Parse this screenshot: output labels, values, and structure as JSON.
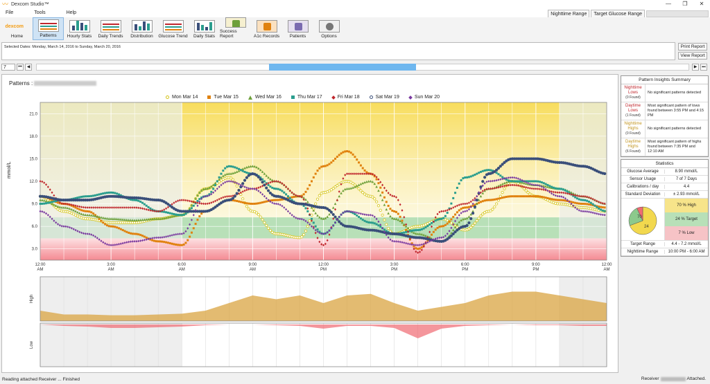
{
  "app": {
    "title": "Dexcom Studio™",
    "logo_text": "dexcom"
  },
  "window_buttons": [
    "—",
    "❐",
    "✕"
  ],
  "menu": [
    "File",
    "Tools",
    "Help"
  ],
  "topright": {
    "nighttime_range": "Nighttime Range",
    "target_glucose_range": "Target Glucose Range"
  },
  "toolbar": [
    {
      "label": "Home",
      "icon": "home-icon"
    },
    {
      "label": "Patterns",
      "icon": "patterns-icon",
      "active": true
    },
    {
      "label": "Hourly Stats",
      "icon": "hourly-stats-icon"
    },
    {
      "label": "Daily Trends",
      "icon": "daily-trends-icon"
    },
    {
      "label": "Distribution",
      "icon": "distribution-icon"
    },
    {
      "label": "Glucose Trend",
      "icon": "glucose-trend-icon"
    },
    {
      "label": "Daily Stats",
      "icon": "daily-stats-icon"
    },
    {
      "label": "Success Report",
      "icon": "success-report-icon"
    },
    {
      "label": "A1c Records",
      "icon": "a1c-records-icon"
    },
    {
      "label": "Patients",
      "icon": "patients-icon"
    },
    {
      "label": "Options",
      "icon": "options-icon"
    }
  ],
  "dates": {
    "selected": "Selected Dates: Monday, March 14, 2016 to Sunday, March 20, 2016"
  },
  "report_buttons": {
    "print": "Print Report",
    "view": "View Report"
  },
  "nav": {
    "days": "7",
    "first": "⏮",
    "prev": "◀",
    "next": "▶",
    "last": "⏭"
  },
  "patterns": {
    "title": "Patterns :"
  },
  "colors": {
    "high": "#f5d76a",
    "target": "#b8e0b8",
    "low": "#f6a3a8",
    "accent": "#6fb7ef"
  },
  "chart_data": {
    "type": "scatter",
    "ylabel": "mmol/L",
    "yticks": [
      "3.0",
      "6.0",
      "9.0",
      "12.0",
      "15.0",
      "18.0",
      "21.0"
    ],
    "ylim": [
      1.5,
      22.5
    ],
    "xticks": [
      "12:00\nAM",
      "3:00\nAM",
      "6:00\nAM",
      "9:00\nAM",
      "12:00\nPM",
      "3:00\nPM",
      "6:00\nPM",
      "9:00\nPM",
      "12:00\nAM"
    ],
    "target_range": [
      4.4,
      7.2
    ],
    "series": [
      {
        "name": "Mon Mar 14",
        "color": "#d4c418",
        "marker": "circle",
        "x": [
          0,
          1,
          2,
          3,
          4,
          5,
          6,
          7,
          8,
          9,
          10,
          11,
          12,
          13,
          14,
          15,
          16,
          17,
          18,
          19,
          20,
          21,
          22,
          23,
          24
        ],
        "y": [
          10,
          8,
          7,
          6.5,
          6.5,
          7,
          7.5,
          11,
          12.5,
          8,
          5,
          4.5,
          10.5,
          12,
          10,
          5,
          6,
          7,
          5.5,
          8,
          12,
          10,
          9,
          8.5,
          8
        ]
      },
      {
        "name": "Tue Mar 15",
        "color": "#e0820f",
        "marker": "square",
        "x": [
          0,
          1,
          2,
          3,
          4,
          5,
          6,
          7,
          8,
          9,
          10,
          11,
          12,
          13,
          14,
          15,
          16,
          17,
          18,
          19,
          20,
          21,
          22,
          23,
          24
        ],
        "y": [
          10,
          9,
          8,
          6,
          5,
          4,
          3.5,
          8,
          9.5,
          9,
          9.5,
          10,
          14,
          16,
          13,
          8,
          3,
          6,
          8.5,
          9.5,
          10,
          10,
          9.5,
          9,
          8.5
        ]
      },
      {
        "name": "Wed Mar 16",
        "color": "#6ea03a",
        "marker": "triangle",
        "x": [
          0,
          1,
          2,
          3,
          4,
          5,
          6,
          7,
          8,
          9,
          10,
          11,
          12,
          13,
          14,
          15,
          16,
          17,
          18,
          19,
          20,
          21,
          22,
          23,
          24
        ],
        "y": [
          9.5,
          8.5,
          7.5,
          7,
          6.8,
          7,
          7.5,
          11,
          13,
          14,
          12,
          10,
          7,
          11,
          12,
          7,
          5,
          4,
          7,
          11,
          12,
          11.5,
          11,
          10,
          9
        ]
      },
      {
        "name": "Thu Mar 17",
        "color": "#2b9e8e",
        "marker": "square",
        "x": [
          0,
          1,
          2,
          3,
          4,
          5,
          6,
          7,
          8,
          9,
          10,
          11,
          12,
          13,
          14,
          15,
          16,
          17,
          18,
          19,
          20,
          21,
          22,
          23,
          24
        ],
        "y": [
          9,
          9.5,
          10,
          10.5,
          9.5,
          8,
          7.5,
          10,
          14,
          13,
          11,
          9,
          5,
          8,
          6.5,
          5,
          5.5,
          7,
          12.5,
          13.5,
          12,
          12,
          11,
          9.5,
          8
        ]
      },
      {
        "name": "Fri Mar 18",
        "color": "#c0272d",
        "marker": "diamond",
        "x": [
          0,
          1,
          2,
          3,
          4,
          5,
          6,
          7,
          8,
          9,
          10,
          11,
          12,
          13,
          14,
          15,
          16,
          17,
          18,
          19,
          20,
          21,
          22,
          23,
          24
        ],
        "y": [
          12,
          9,
          8.5,
          8.5,
          8.5,
          8,
          9.5,
          9,
          10,
          11,
          12,
          10,
          3.5,
          13,
          13,
          10,
          2.5,
          8,
          9,
          11,
          11.5,
          11,
          10.5,
          10,
          9
        ]
      },
      {
        "name": "Sat Mar 19",
        "color": "#3a4f7a",
        "marker": "circle",
        "x": [
          0,
          1,
          2,
          3,
          4,
          5,
          6,
          7,
          8,
          9,
          10,
          11,
          12,
          13,
          14,
          15,
          16,
          17,
          18,
          19,
          20,
          21,
          22,
          23,
          24
        ],
        "y": [
          10,
          9.5,
          9.5,
          10,
          9.8,
          9.5,
          8,
          8,
          9.5,
          13,
          10,
          9,
          8.5,
          6,
          5.5,
          5,
          4.5,
          4,
          6,
          13,
          15,
          15,
          14.5,
          14,
          13
        ]
      },
      {
        "name": "Sun Mar 20",
        "color": "#7a3aa0",
        "marker": "diamond",
        "x": [
          0,
          1,
          2,
          3,
          4,
          5,
          6,
          7,
          8,
          9,
          10,
          11,
          12,
          13,
          14,
          15,
          16,
          17,
          18,
          19,
          20,
          21,
          22,
          23,
          24
        ],
        "y": [
          8,
          6,
          5,
          3.5,
          4,
          4.5,
          5,
          10,
          12,
          11,
          9,
          7,
          5,
          8,
          7.5,
          4,
          3.5,
          4.5,
          8,
          12,
          12.5,
          11.5,
          10,
          8,
          7.5
        ]
      }
    ],
    "high_label": "High",
    "low_label": "Low",
    "high_area": [
      1,
      0.5,
      0.5,
      0.4,
      0.4,
      0.5,
      0.6,
      1,
      2,
      3,
      2.5,
      3,
      2,
      3,
      3.2,
      2,
      1,
      1.5,
      2,
      3,
      3.5,
      3.5,
      3,
      2.5,
      2
    ],
    "low_area": [
      0,
      0.2,
      0.3,
      0.5,
      0.5,
      0.4,
      0.3,
      0.1,
      0,
      0,
      0.1,
      0.2,
      0.6,
      0.2,
      0.2,
      0.5,
      2,
      0.6,
      0.2,
      0.1,
      0,
      0.1,
      0.1,
      0.2,
      0.2
    ]
  },
  "insights": {
    "title": "Pattern Insights Summary",
    "rows": [
      {
        "label": "Nighttime Lows",
        "count": "(0 Found)",
        "color": "#c0272d",
        "desc": "No significant patterns detected"
      },
      {
        "label": "Daytime Lows",
        "count": "(1 Found)",
        "color": "#c0272d",
        "desc": "Most significant pattern of lows found between 3:55 PM and 4:15 PM"
      },
      {
        "label": "Nighttime Highs",
        "count": "(0 Found)",
        "color": "#c29520",
        "desc": "No significant patterns detected"
      },
      {
        "label": "Daytime Highs",
        "count": "(6 Found)",
        "color": "#c29520",
        "desc": "Most significant pattern of highs found between 7:35 PM and 12:10 AM"
      }
    ]
  },
  "statistics": {
    "title": "Statistics",
    "rows": [
      {
        "k": "Glucose Average",
        "v": "8.90 mmol/L"
      },
      {
        "k": "Sensor Usage",
        "v": "7 of 7 Days"
      },
      {
        "k": "Calibrations / day",
        "v": "4.4"
      },
      {
        "k": "Standard Deviation",
        "v": "± 2.93 mmol/L"
      }
    ],
    "pie": {
      "high": 70,
      "target": 24,
      "low": 7
    },
    "pie_labels": {
      "high": "70",
      "target": "24"
    },
    "bars": {
      "high": "70 % High",
      "target": "24 % Target",
      "low": "7 % Low"
    },
    "bottom": [
      {
        "k": "Target Range",
        "v": "4.4 - 7.2 mmol/L"
      },
      {
        "k": "Nighttime Range",
        "v": "10:00 PM - 6:00 AM"
      }
    ]
  },
  "status": {
    "left": "Reading attached Receiver ... Finished",
    "receiver": "Receiver",
    "attached": "Attached."
  }
}
